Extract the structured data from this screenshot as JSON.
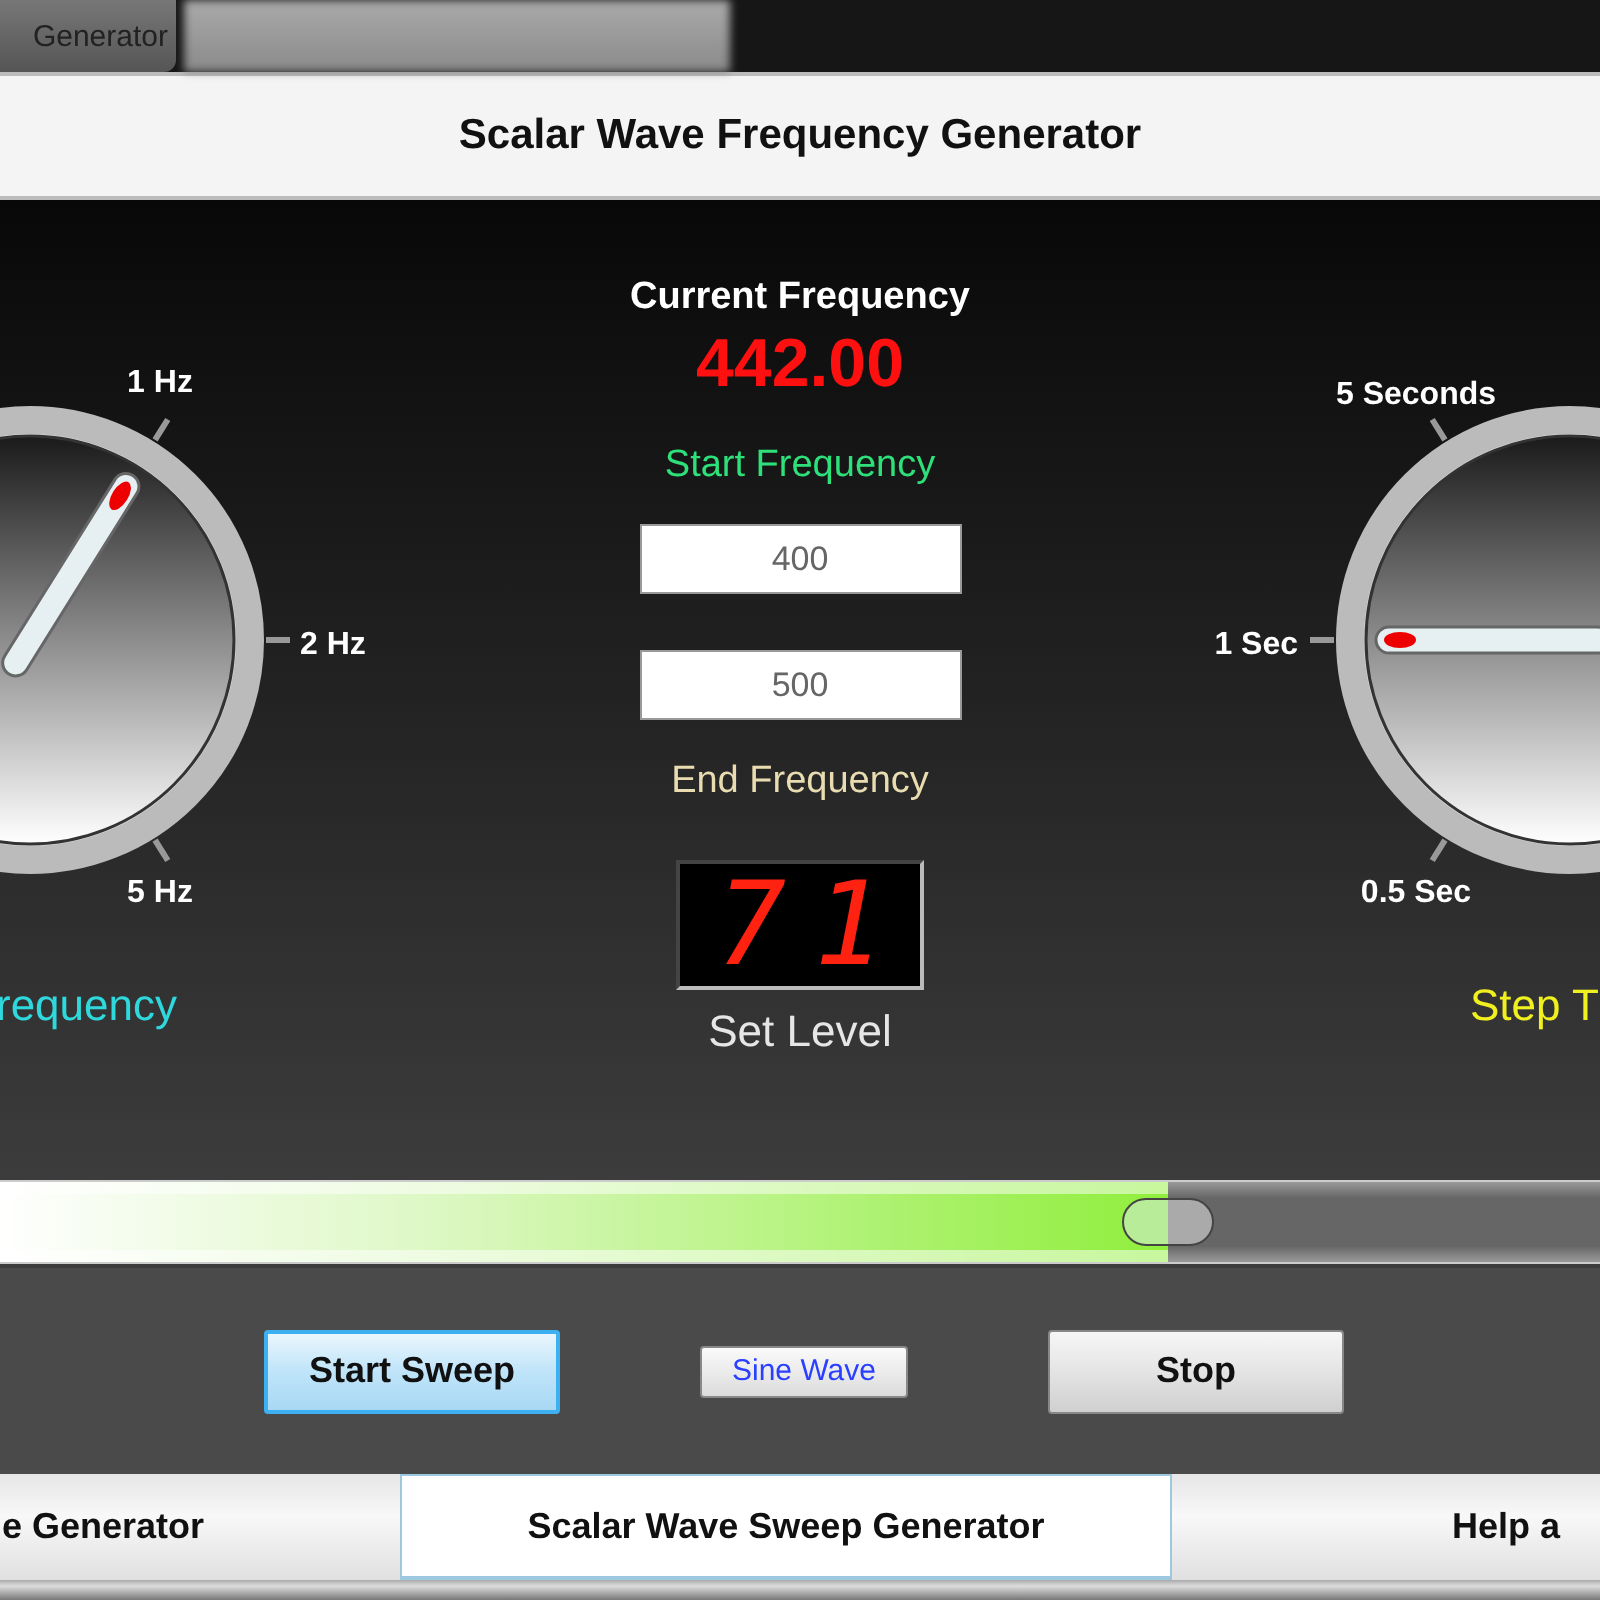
{
  "top_tab": {
    "label": "Generator"
  },
  "window": {
    "title": "Scalar Wave Frequency Generator"
  },
  "left_knob": {
    "caption": "requency",
    "ticks": [
      {
        "label": "1 Hz"
      },
      {
        "label": "2 Hz"
      },
      {
        "label": "5 Hz"
      }
    ]
  },
  "center": {
    "current_label": "Current Frequency",
    "current_value": "442.00",
    "start_label": "Start Frequency",
    "start_value": "400",
    "end_value": "500",
    "end_label": "End Frequency",
    "display": "71",
    "display_label": "Set Level"
  },
  "right_knob": {
    "caption": "Step T",
    "ticks": [
      {
        "label": "5 Seconds"
      },
      {
        "label": "1 Sec"
      },
      {
        "label": "0.5 Sec"
      }
    ]
  },
  "slider": {
    "level": 0.73
  },
  "buttons": [
    {
      "label": "Start Sweep",
      "kind": "primary",
      "focused": true
    },
    {
      "label": "Sine Wave",
      "kind": "small",
      "focused": false
    },
    {
      "label": "Stop",
      "kind": "primary",
      "focused": false
    }
  ],
  "tabs": [
    {
      "label": "e Generator",
      "selected": false
    },
    {
      "label": "Scalar Wave Sweep Generator",
      "selected": true
    },
    {
      "label": "Help a",
      "selected": false
    }
  ]
}
